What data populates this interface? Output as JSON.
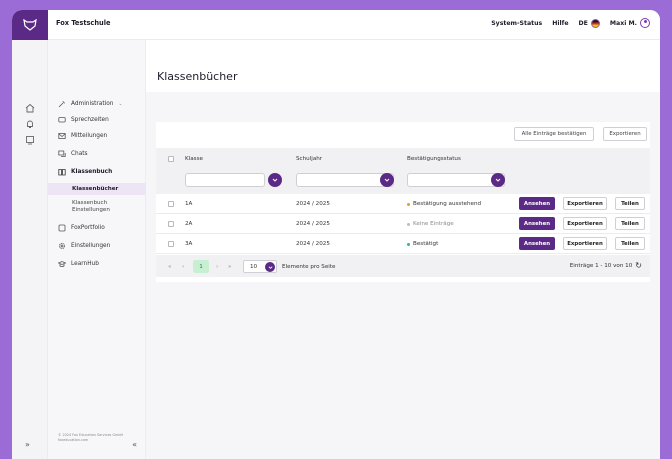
{
  "app": {
    "school_name": "Fox Testschule",
    "system_status": "System-Status",
    "help": "Hilfe",
    "language": "DE",
    "user_name": "Maxi M."
  },
  "sidebar": {
    "items": [
      {
        "label": "Administration",
        "icon": "tools-icon"
      },
      {
        "label": "Sprechzeiten",
        "icon": "chat-bubbles-icon"
      },
      {
        "label": "Mitteilungen",
        "icon": "mail-icon"
      },
      {
        "label": "Chats",
        "icon": "chat-icon"
      },
      {
        "label": "Klassenbuch",
        "icon": "book-icon"
      },
      {
        "label": "FoxPortfolio",
        "icon": "portfolio-icon"
      },
      {
        "label": "Einstellungen",
        "icon": "gear-icon"
      },
      {
        "label": "LearnHub",
        "icon": "graduation-icon"
      }
    ],
    "sub_items": [
      {
        "label": "Klassenbücher"
      },
      {
        "label_line1": "Klassenbuch",
        "label_line2": "Einstellungen"
      }
    ],
    "footer_line1": "© 2024 Fox Education Services GmbH",
    "footer_line2": "foxeducation.com"
  },
  "main": {
    "title": "Klassenbücher",
    "confirm_all_label": "Alle Einträge bestätigen",
    "export_label": "Exportieren",
    "columns": [
      "Klasse",
      "Schuljahr",
      "Bestätigungsstatus"
    ],
    "rows": [
      {
        "klasse": "1A",
        "schuljahr": "2024 / 2025",
        "status": "Bestätigung ausstehend",
        "status_color": "#f29a1f"
      },
      {
        "klasse": "2A",
        "schuljahr": "2024 / 2025",
        "status": "Keine Einträge",
        "status_color": "#bdbdc4"
      },
      {
        "klasse": "3A",
        "schuljahr": "2024 / 2025",
        "status": "Bestätigt",
        "status_color": "#2ec06a"
      }
    ],
    "row_actions": {
      "view": "Ansehen",
      "export": "Exportieren",
      "share": "Teilen"
    },
    "pagination": {
      "first": "«",
      "prev": "‹",
      "current_page": "1",
      "next": "›",
      "last": "»",
      "page_size": "10",
      "per_page_label": "Elemente pro Seite",
      "entries_label": "Einträge 1 - 10 von 10"
    }
  },
  "colors": {
    "brand": "#5b2a86",
    "accent_bg": "#9b6cd6"
  }
}
